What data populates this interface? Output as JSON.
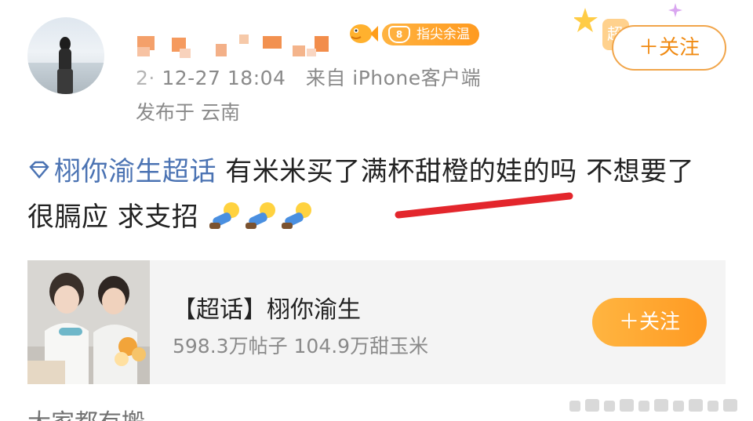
{
  "header": {
    "badge_level": "8",
    "badge_label": "指尖余温",
    "timestamp_visible": "12-27 18:04",
    "source": "来自 iPhone客户端",
    "location": "发布于 云南",
    "follow_label": "＋关注",
    "deco_text": "超"
  },
  "post": {
    "topic": "栩你渝生超话",
    "text": " 有米米买了满杯甜橙的娃的吗 不想要了 很膈应 求支招"
  },
  "card": {
    "title": "【超话】栩你渝生",
    "stats": "598.3万帖子 104.9万甜玉米",
    "follow_label": "＋关注"
  },
  "footer": {
    "partial_text": "大家都有搬"
  },
  "colors": {
    "accent": "#f08a12",
    "link": "#4b73b3",
    "meta": "#8a8a8a",
    "card_bg": "#f4f4f4"
  }
}
